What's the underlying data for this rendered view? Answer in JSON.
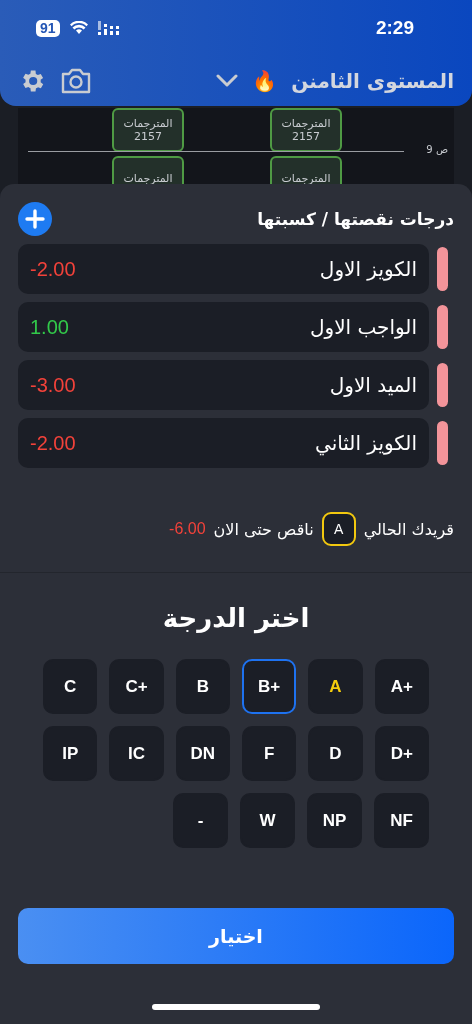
{
  "status_bar": {
    "battery": "91",
    "time": "2:29"
  },
  "header": {
    "title": "المستوى الثامنن",
    "emoji": "🔥"
  },
  "calendar": {
    "hour_label": "9 ص",
    "events": [
      {
        "title": "المترجمات",
        "number": "2157"
      },
      {
        "title": "المترجمات",
        "number": "2157"
      },
      {
        "title": "المترجمات"
      },
      {
        "title": "المترجمات"
      }
    ]
  },
  "adjustments": {
    "title": "درجات نقصتها / كسبتها",
    "items": [
      {
        "name": "الكويز الاول",
        "value": "-2.00",
        "kind": "loss"
      },
      {
        "name": "الواجب الاول",
        "value": "1.00",
        "kind": "gain"
      },
      {
        "name": "الميد الاول",
        "value": "-3.00",
        "kind": "loss"
      },
      {
        "name": "الكويز الثاني",
        "value": "-2.00",
        "kind": "loss"
      }
    ]
  },
  "summary": {
    "label": "قريدك الحالي",
    "grade": "A",
    "deficit_label": "ناقص حتى الان",
    "deficit": "-6.00"
  },
  "picker": {
    "title": "اختر الدرجة",
    "rows": [
      [
        {
          "label": "A+",
          "selected": false,
          "current": false
        },
        {
          "label": "A",
          "selected": false,
          "current": true
        },
        {
          "label": "B+",
          "selected": true,
          "current": false
        },
        {
          "label": "B",
          "selected": false,
          "current": false
        },
        {
          "label": "C+",
          "selected": false,
          "current": false
        },
        {
          "label": "C",
          "selected": false,
          "current": false
        }
      ],
      [
        {
          "label": "D+",
          "selected": false,
          "current": false
        },
        {
          "label": "D",
          "selected": false,
          "current": false
        },
        {
          "label": "F",
          "selected": false,
          "current": false
        },
        {
          "label": "DN",
          "selected": false,
          "current": false
        },
        {
          "label": "IC",
          "selected": false,
          "current": false
        },
        {
          "label": "IP",
          "selected": false,
          "current": false
        }
      ],
      [
        {
          "label": "NF",
          "selected": false,
          "current": false
        },
        {
          "label": "NP",
          "selected": false,
          "current": false
        },
        {
          "label": "W",
          "selected": false,
          "current": false
        },
        {
          "label": "-",
          "selected": false,
          "current": false
        }
      ]
    ]
  },
  "confirm_button": "اختيار"
}
